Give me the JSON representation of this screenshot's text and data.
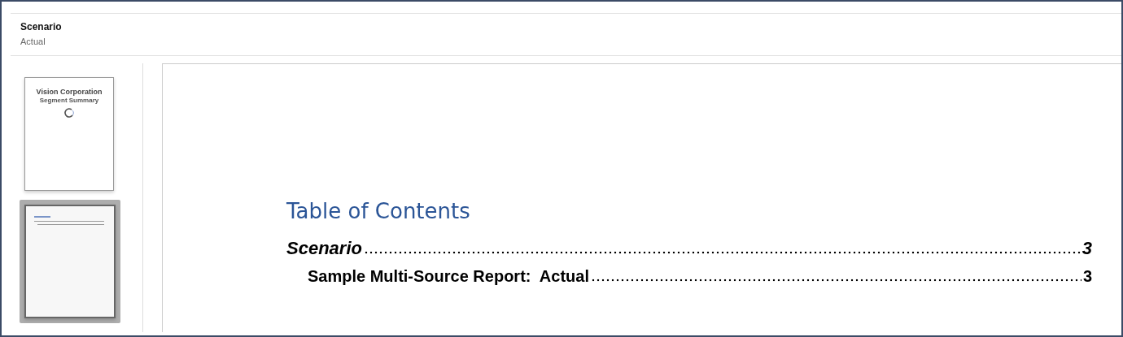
{
  "header": {
    "title": "Scenario",
    "subtitle": "Actual"
  },
  "thumbnails": [
    {
      "kind": "cover",
      "title": "Vision Corporation",
      "subtitle": "Segment Summary",
      "selected": false
    },
    {
      "kind": "toc",
      "selected": true
    }
  ],
  "page": {
    "heading": "Table of Contents",
    "entries": [
      {
        "title": "Scenario",
        "page": "3",
        "italic": true,
        "children": [
          {
            "title": "Sample Multi-Source Report:  Actual",
            "page": "3",
            "italic": false
          }
        ]
      }
    ]
  }
}
